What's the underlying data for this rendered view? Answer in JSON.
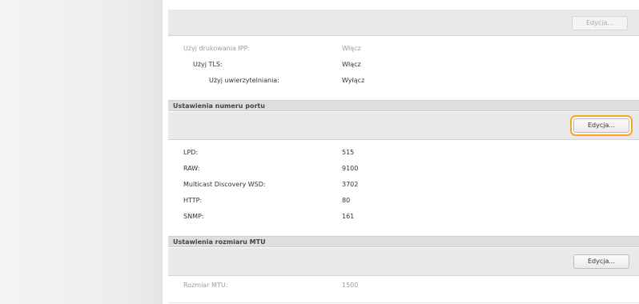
{
  "top_panel": {
    "button_label": "Edycja..."
  },
  "ipp_settings": [
    {
      "label": "Użyj drukowania IPP:",
      "value": "Włącz"
    },
    {
      "label": "Użyj TLS:",
      "value": "Włącz"
    },
    {
      "label": "Użyj uwierzytelniania:",
      "value": "Wyłącz"
    }
  ],
  "port_section": {
    "title": "Ustawienia numeru portu",
    "button_label": "Edycja...",
    "rows": [
      {
        "label": "LPD:",
        "value": "515"
      },
      {
        "label": "RAW:",
        "value": "9100"
      },
      {
        "label": "Multicast Discovery WSD:",
        "value": "3702"
      },
      {
        "label": "HTTP:",
        "value": "80"
      },
      {
        "label": "SNMP:",
        "value": "161"
      }
    ]
  },
  "mtu_section": {
    "title": "Ustawienia rozmiaru MTU",
    "button_label": "Edycja...",
    "rows": [
      {
        "label": "Rozmiar MTU:",
        "value": "1500"
      }
    ]
  },
  "colors": {
    "highlight": "#f5a623"
  }
}
